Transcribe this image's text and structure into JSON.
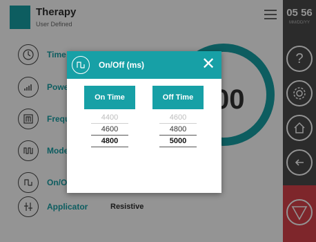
{
  "header": {
    "title": "Therapy",
    "subtitle": "User Defined"
  },
  "rail": {
    "clock": "05 56",
    "date": "MM/DD/YY"
  },
  "menu": [
    {
      "label": "Time"
    },
    {
      "label": "Power"
    },
    {
      "label": "Frequency"
    },
    {
      "label": "Mode"
    },
    {
      "label": "On/Off"
    },
    {
      "label": "Applicator",
      "value": "Resistive"
    }
  ],
  "gauge": {
    "value": "00"
  },
  "dialog": {
    "title": "On/Off (ms)",
    "close": "✕",
    "on_time": {
      "label": "On Time",
      "values": [
        "4400",
        "4600",
        "4800"
      ]
    },
    "off_time": {
      "label": "Off Time",
      "values": [
        "4600",
        "4800",
        "5000"
      ]
    }
  },
  "colors": {
    "accent": "#17a0a6",
    "stop": "#d9434b",
    "rail": "#4a4a4a"
  }
}
